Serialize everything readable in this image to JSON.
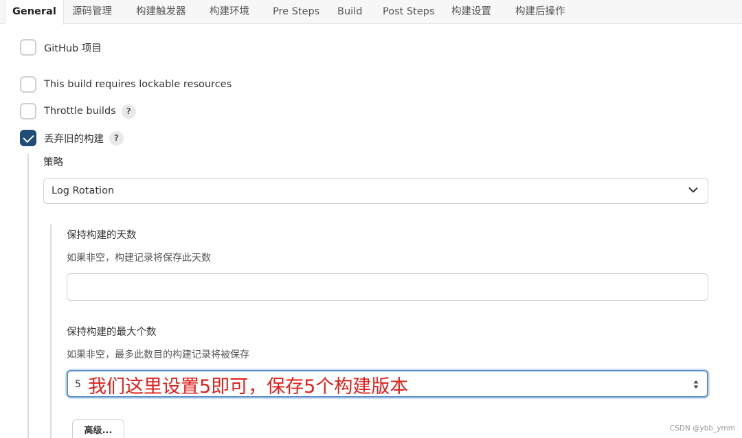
{
  "tabs": [
    "General",
    "源码管理",
    "构建触发器",
    "构建环境",
    "Pre Steps",
    "Build",
    "Post Steps",
    "构建设置",
    "构建后操作"
  ],
  "options": {
    "github_project": "GitHub 项目",
    "lockable_resources": "This build requires lockable resources",
    "throttle_builds": "Throttle builds",
    "discard_old_builds": "丢弃旧的构建"
  },
  "help_label": "?",
  "strategy": {
    "label": "策略",
    "selected": "Log Rotation"
  },
  "days_to_keep": {
    "label": "保持构建的天数",
    "description": "如果非空，构建记录将保存此天数",
    "value": ""
  },
  "max_builds": {
    "label": "保持构建的最大个数",
    "description": "如果非空，最多此数目的构建记录将被保存",
    "value": "5"
  },
  "annotation": "我们这里设置5即可，保存5个构建版本",
  "advanced_button": "高级...",
  "watermark": "CSDN @ybb_ymm",
  "colors": {
    "checkbox_checked": "#1f4d78",
    "focus_border": "#5a8fc7",
    "annotation": "#e0201b"
  }
}
